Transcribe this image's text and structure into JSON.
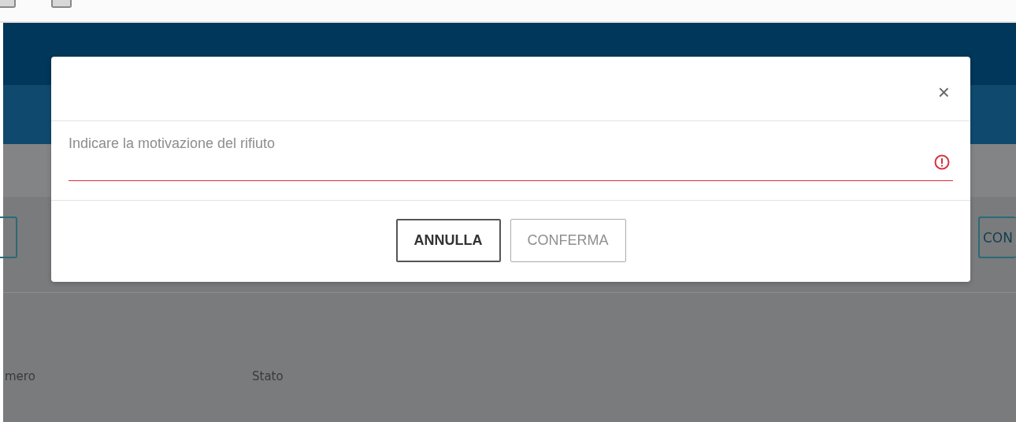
{
  "background": {
    "toolbar_button": {
      "label": "CON"
    },
    "table_headers": [
      "mero",
      "Stato"
    ]
  },
  "dialog": {
    "close_label": "×",
    "field": {
      "placeholder": "Indicare la motivazione del rifiuto",
      "invalid": true
    },
    "buttons": [
      {
        "label": "ANNULLA",
        "disabled": false
      },
      {
        "label": "CONFERMA",
        "disabled": true
      }
    ]
  }
}
